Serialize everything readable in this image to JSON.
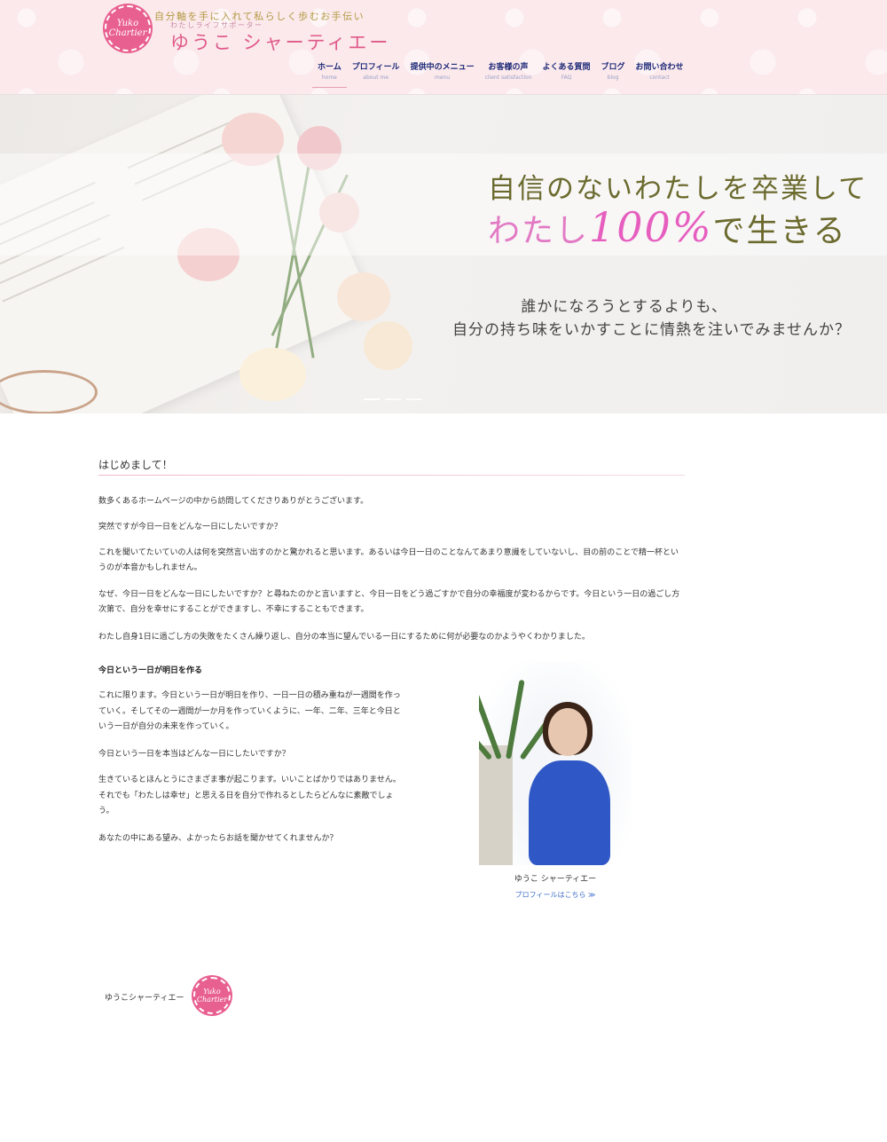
{
  "header": {
    "badge_text": "Yuko Chartier",
    "tagline": "自分軸を手に入れて私らしく歩むお手伝い",
    "subtag": "わたしライフサポーター",
    "site_name": "ゆうこ シャーティエー"
  },
  "nav": [
    {
      "label": "ホーム",
      "sub": "home"
    },
    {
      "label": "プロフィール",
      "sub": "about me"
    },
    {
      "label": "提供中のメニュー",
      "sub": "menu"
    },
    {
      "label": "お客様の声",
      "sub": "client satisfaction"
    },
    {
      "label": "よくある質問",
      "sub": "FAQ"
    },
    {
      "label": "ブログ",
      "sub": "blog"
    },
    {
      "label": "お問い合わせ",
      "sub": "contact"
    }
  ],
  "hero": {
    "line1": "自信のないわたしを卒業して",
    "line2_a": "わたし",
    "line2_b": "100%",
    "line2_c": "で生きる",
    "sub1": "誰かになろうとするよりも、",
    "sub2": "自分の持ち味をいかすことに情熱を注いでみませんか？",
    "slides": 3
  },
  "content": {
    "title": "はじめまして！",
    "p1": "数多くあるホームページの中から訪問してくださりありがとうございます。",
    "p2": "突然ですが今日一日をどんな一日にしたいですか？",
    "p3": "これを聞いてたいていの人は何を突然言い出すのかと驚かれると思います。あるいは今日一日のことなんてあまり意識をしていないし、目の前のことで精一杯というのが本音かもしれません。",
    "p4": "なぜ、今日一日をどんな一日にしたいですか？と尋ねたのかと言いますと、今日一日をどう過ごすかで自分の幸福度が変わるからです。今日という一日の過ごし方次第で、自分を幸せにすることができますし、不幸にすることもできます。",
    "p5": "わたし自身1日に過ごし方の失敗をたくさん繰り返し、自分の本当に望んでいる一日にするために何が必要なのかようやくわかりました。",
    "subheading": "今日という一日が明日を作る",
    "p6": "これに限ります。今日という一日が明日を作り、一日一日の積み重ねが一週間を作っていく。そしてその一週間が一か月を作っていくように、一年、二年、三年と今日という一日が自分の未来を作っていく。",
    "p7": "今日という一日を本当はどんな一日にしたいですか？",
    "p8": "生きているとほんとうにさまざま事が起こります。いいことばかりではありません。それでも「わたしは幸せ」と思える日を自分で作れるとしたらどんなに素敵でしょう。",
    "p9": "あなたの中にある望み、よかったらお話を聞かせてくれませんか？",
    "photo_caption": "ゆうこ シャーティエー",
    "photo_link": "プロフィールはこちら ≫"
  },
  "footer": {
    "name": "ゆうこシャーティエー",
    "badge_text": "Yuko Chartier"
  }
}
